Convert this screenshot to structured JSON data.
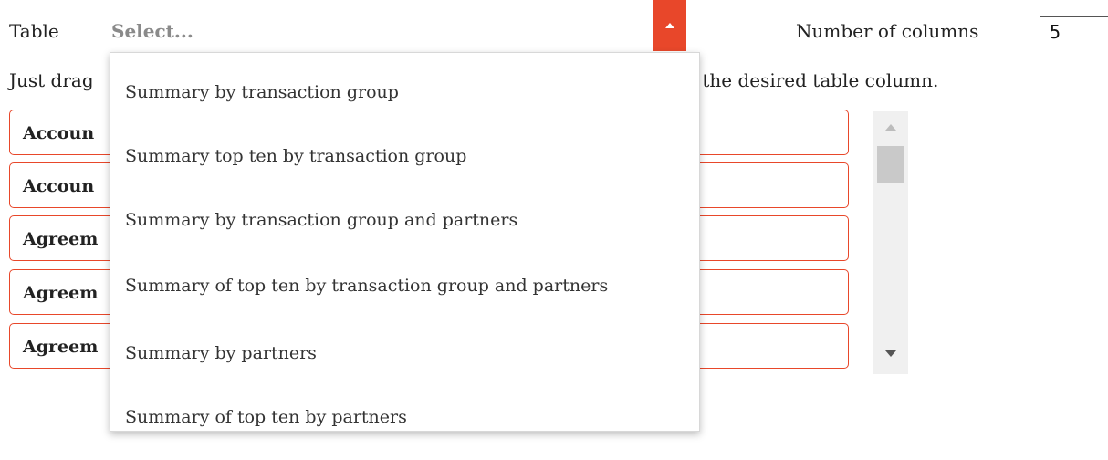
{
  "form": {
    "table_label": "Table",
    "select_placeholder": "Select...",
    "number_of_columns_label": "Number of columns",
    "number_of_columns_value": "5",
    "instruction_start": "Just drag",
    "instruction_end": "n to the desired table column."
  },
  "dropdown": {
    "options": [
      "Summary by transaction group",
      "Summary top ten by transaction group",
      "Summary by transaction group and partners",
      "Summary of top ten by transaction group and partners",
      "Summary by partners",
      "Summary of top ten by partners"
    ]
  },
  "fields": [
    "Accoun",
    "Accoun",
    "Agreem",
    "Agreem",
    "Agreem"
  ],
  "colors": {
    "accent": "#e8472a",
    "placeholder": "#8a8a8a",
    "scrollbar_track": "#f0f0f0"
  }
}
